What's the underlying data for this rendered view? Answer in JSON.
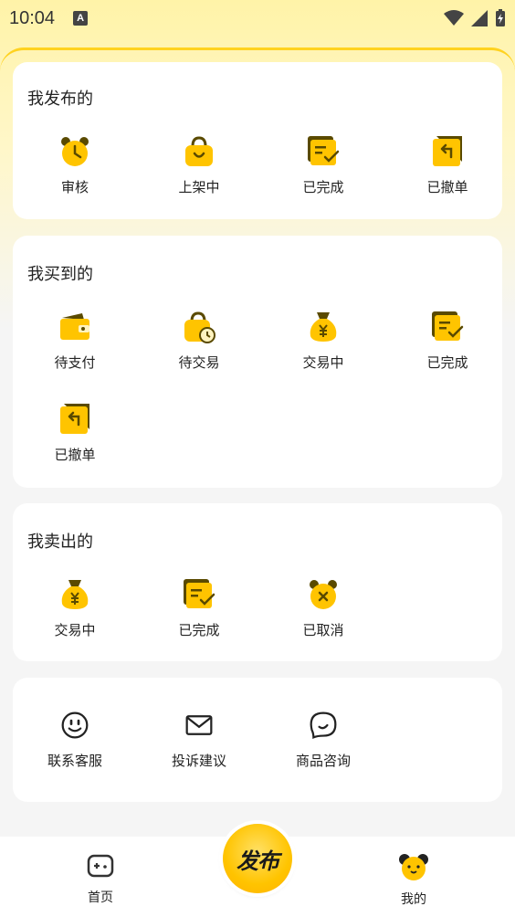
{
  "status_bar": {
    "time": "10:04",
    "indicator": "A"
  },
  "published": {
    "title": "我发布的",
    "items": [
      {
        "label": "审核",
        "icon": "alarm-clock-icon"
      },
      {
        "label": "上架中",
        "icon": "shopping-bag-icon"
      },
      {
        "label": "已完成",
        "icon": "completed-doc-icon"
      },
      {
        "label": "已撤单",
        "icon": "revoke-icon"
      }
    ]
  },
  "bought": {
    "title": "我买到的",
    "items": [
      {
        "label": "待支付",
        "icon": "wallet-icon"
      },
      {
        "label": "待交易",
        "icon": "bag-clock-icon"
      },
      {
        "label": "交易中",
        "icon": "money-bag-icon"
      },
      {
        "label": "已完成",
        "icon": "completed-doc-icon"
      },
      {
        "label": "已撤单",
        "icon": "revoke-icon"
      }
    ]
  },
  "sold": {
    "title": "我卖出的",
    "items": [
      {
        "label": "交易中",
        "icon": "money-bag-icon"
      },
      {
        "label": "已完成",
        "icon": "completed-doc-icon"
      },
      {
        "label": "已取消",
        "icon": "cancel-clock-icon"
      }
    ]
  },
  "services": {
    "items": [
      {
        "label": "联系客服",
        "icon": "smiley-icon"
      },
      {
        "label": "投诉建议",
        "icon": "mail-icon"
      },
      {
        "label": "商品咨询",
        "icon": "chat-bubble-icon"
      }
    ]
  },
  "nav": {
    "home": "首页",
    "publish": "发布",
    "mine": "我的"
  },
  "colors": {
    "accent": "#ffc400",
    "accent_dark": "#5a4a00"
  }
}
